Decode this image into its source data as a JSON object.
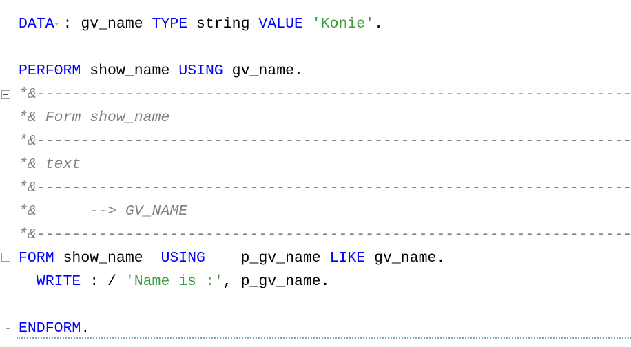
{
  "editor": {
    "language": "ABAP",
    "lines": {
      "l0_star": "*",
      "data_kw": "DATA",
      "data_colon": " : ",
      "data_var": "gv_name ",
      "type_kw": "TYPE",
      "type_name": " string ",
      "value_kw": "VALUE",
      "value_str": " 'Konie'",
      "data_dot": ".",
      "star_line": "*",
      "perform_kw": "PERFORM",
      "perform_rest": " show_name ",
      "using_kw": "USING",
      "perform_arg": " gv_name.",
      "c1": "*&---------------------------------------------------------------------",
      "c2": "*& Form show_name",
      "c3": "*&---------------------------------------------------------------------",
      "c4": "*& text",
      "c5": "*&---------------------------------------------------------------------",
      "c6": "*&      --> GV_NAME",
      "c7": "*&---------------------------------------------------------------------",
      "form_kw": "FORM",
      "form_name": " show_name  ",
      "form_using_kw": "USING",
      "form_param": "    p_gv_name ",
      "like_kw": "LIKE",
      "form_ref": " gv_name.",
      "write_kw": "  WRITE",
      "write_op": " : / ",
      "write_str": "'Name is :'",
      "write_rest": ", p_gv_name.",
      "endform_kw": "ENDFORM",
      "endform_dot": "."
    }
  },
  "colors": {
    "keyword": "#0000ff",
    "string": "#3b9d3b",
    "comment": "#808080",
    "text": "#000000"
  }
}
